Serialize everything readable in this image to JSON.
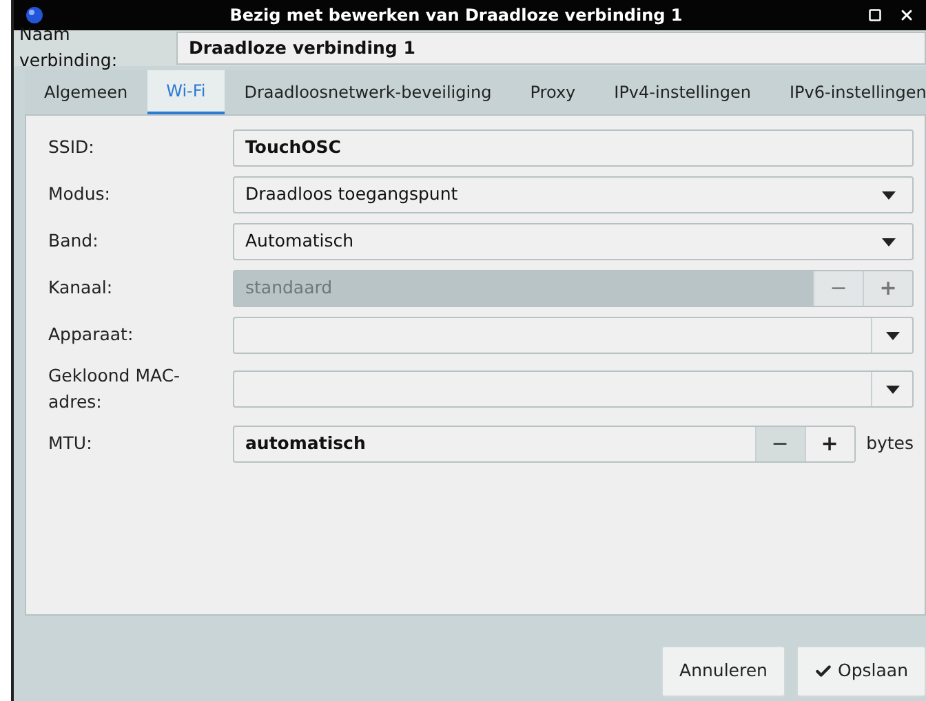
{
  "window": {
    "title": "Bezig met bewerken van Draadloze verbinding 1"
  },
  "connection_name": {
    "label": "Naam verbinding:",
    "value": "Draadloze verbinding 1"
  },
  "tabs": [
    {
      "label": "Algemeen",
      "selected": false
    },
    {
      "label": "Wi-Fi",
      "selected": true
    },
    {
      "label": "Draadloosnetwerk-beveiliging",
      "selected": false
    },
    {
      "label": "Proxy",
      "selected": false
    },
    {
      "label": "IPv4-instellingen",
      "selected": false
    },
    {
      "label": "IPv6-instellingen",
      "selected": false
    }
  ],
  "fields": [
    {
      "kind": "text",
      "label": "SSID:",
      "value": "TouchOSC",
      "disabled": false
    },
    {
      "kind": "combo",
      "label": "Modus:",
      "value": "Draadloos toegangspunt",
      "disabled": false
    },
    {
      "kind": "combo",
      "label": "Band:",
      "value": "Automatisch",
      "disabled": false
    },
    {
      "kind": "spin",
      "label": "Kanaal:",
      "value": "standaard",
      "disabled": true,
      "minus": "−",
      "plus": "+"
    },
    {
      "kind": "combo-entry",
      "label": "Apparaat:",
      "disabled": false
    },
    {
      "kind": "combo-entry",
      "label": "Gekloond MAC-adres:",
      "disabled": false
    },
    {
      "kind": "spin",
      "label": "MTU:",
      "value": "automatisch",
      "disabled": false,
      "minus": "−",
      "plus": "+",
      "unit": "bytes"
    }
  ],
  "buttons": [
    {
      "kind": "plain",
      "label": "Annuleren"
    },
    {
      "kind": "confirm",
      "label": "Opslaan"
    }
  ]
}
